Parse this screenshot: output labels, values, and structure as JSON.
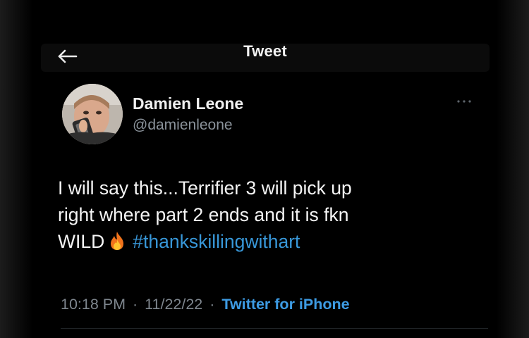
{
  "header": {
    "title": "Tweet",
    "back_icon": "back-arrow-icon"
  },
  "author": {
    "display_name": "Damien Leone",
    "handle": "@damienleone",
    "avatar": "avatar-photo",
    "more_icon": "more-options-icon"
  },
  "tweet": {
    "line1": "I will say this...Terrifier 3 will pick up",
    "line2": "right where part 2 ends and it is fkn",
    "line3_text": "WILD",
    "emoji": "fire-icon",
    "hashtag": "#thankskillingwithart"
  },
  "meta": {
    "time": "10:18 PM",
    "date": "11/22/22",
    "separator": "·",
    "source": "Twitter for iPhone"
  },
  "colors": {
    "background": "#000000",
    "text": "#f4f4f4",
    "secondary_text": "#8b939b",
    "link": "#3897d8"
  }
}
